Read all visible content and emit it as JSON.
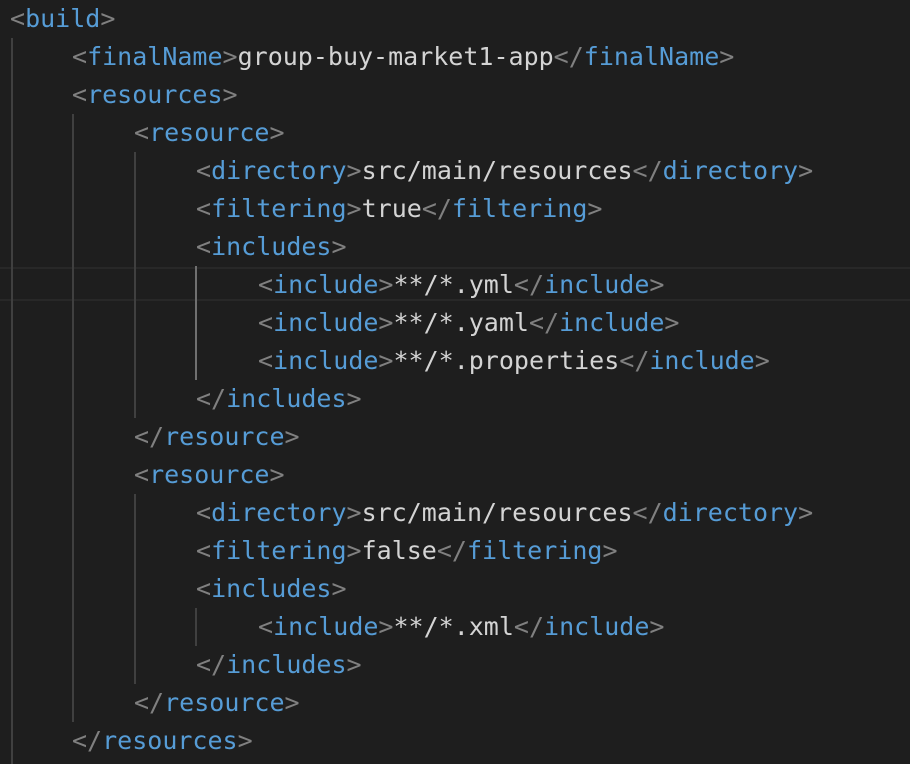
{
  "editor": {
    "lines": [
      {
        "indent": 0,
        "open": "build",
        "text": null,
        "close": null
      },
      {
        "indent": 1,
        "open": "finalName",
        "text": "group-buy-market1-app",
        "close": "finalName"
      },
      {
        "indent": 1,
        "open": "resources",
        "text": null,
        "close": null
      },
      {
        "indent": 2,
        "open": "resource",
        "text": null,
        "close": null
      },
      {
        "indent": 3,
        "open": "directory",
        "text": "src/main/resources",
        "close": "directory"
      },
      {
        "indent": 3,
        "open": "filtering",
        "text": "true",
        "close": "filtering"
      },
      {
        "indent": 3,
        "open": "includes",
        "text": null,
        "close": null
      },
      {
        "indent": 4,
        "open": "include",
        "text": "**/*.yml",
        "close": "include"
      },
      {
        "indent": 4,
        "open": "include",
        "text": "**/*.yaml",
        "close": "include"
      },
      {
        "indent": 4,
        "open": "include",
        "text": "**/*.properties",
        "close": "include"
      },
      {
        "indent": 3,
        "open": null,
        "text": null,
        "close": "includes"
      },
      {
        "indent": 2,
        "open": null,
        "text": null,
        "close": "resource"
      },
      {
        "indent": 2,
        "open": "resource",
        "text": null,
        "close": null
      },
      {
        "indent": 3,
        "open": "directory",
        "text": "src/main/resources",
        "close": "directory"
      },
      {
        "indent": 3,
        "open": "filtering",
        "text": "false",
        "close": "filtering"
      },
      {
        "indent": 3,
        "open": "includes",
        "text": null,
        "close": null
      },
      {
        "indent": 4,
        "open": "include",
        "text": "**/*.xml",
        "close": "include"
      },
      {
        "indent": 3,
        "open": null,
        "text": null,
        "close": "includes"
      },
      {
        "indent": 2,
        "open": null,
        "text": null,
        "close": "resource"
      },
      {
        "indent": 1,
        "open": null,
        "text": null,
        "close": "resources"
      }
    ]
  },
  "colors": {
    "background": "#1e1e1e",
    "punctuation": "#808080",
    "tag_name": "#569cd6",
    "text": "#d4d4d4",
    "indent_guide": "#404040",
    "active_indent_guide": "#707070",
    "current_line_border": "#282828"
  }
}
